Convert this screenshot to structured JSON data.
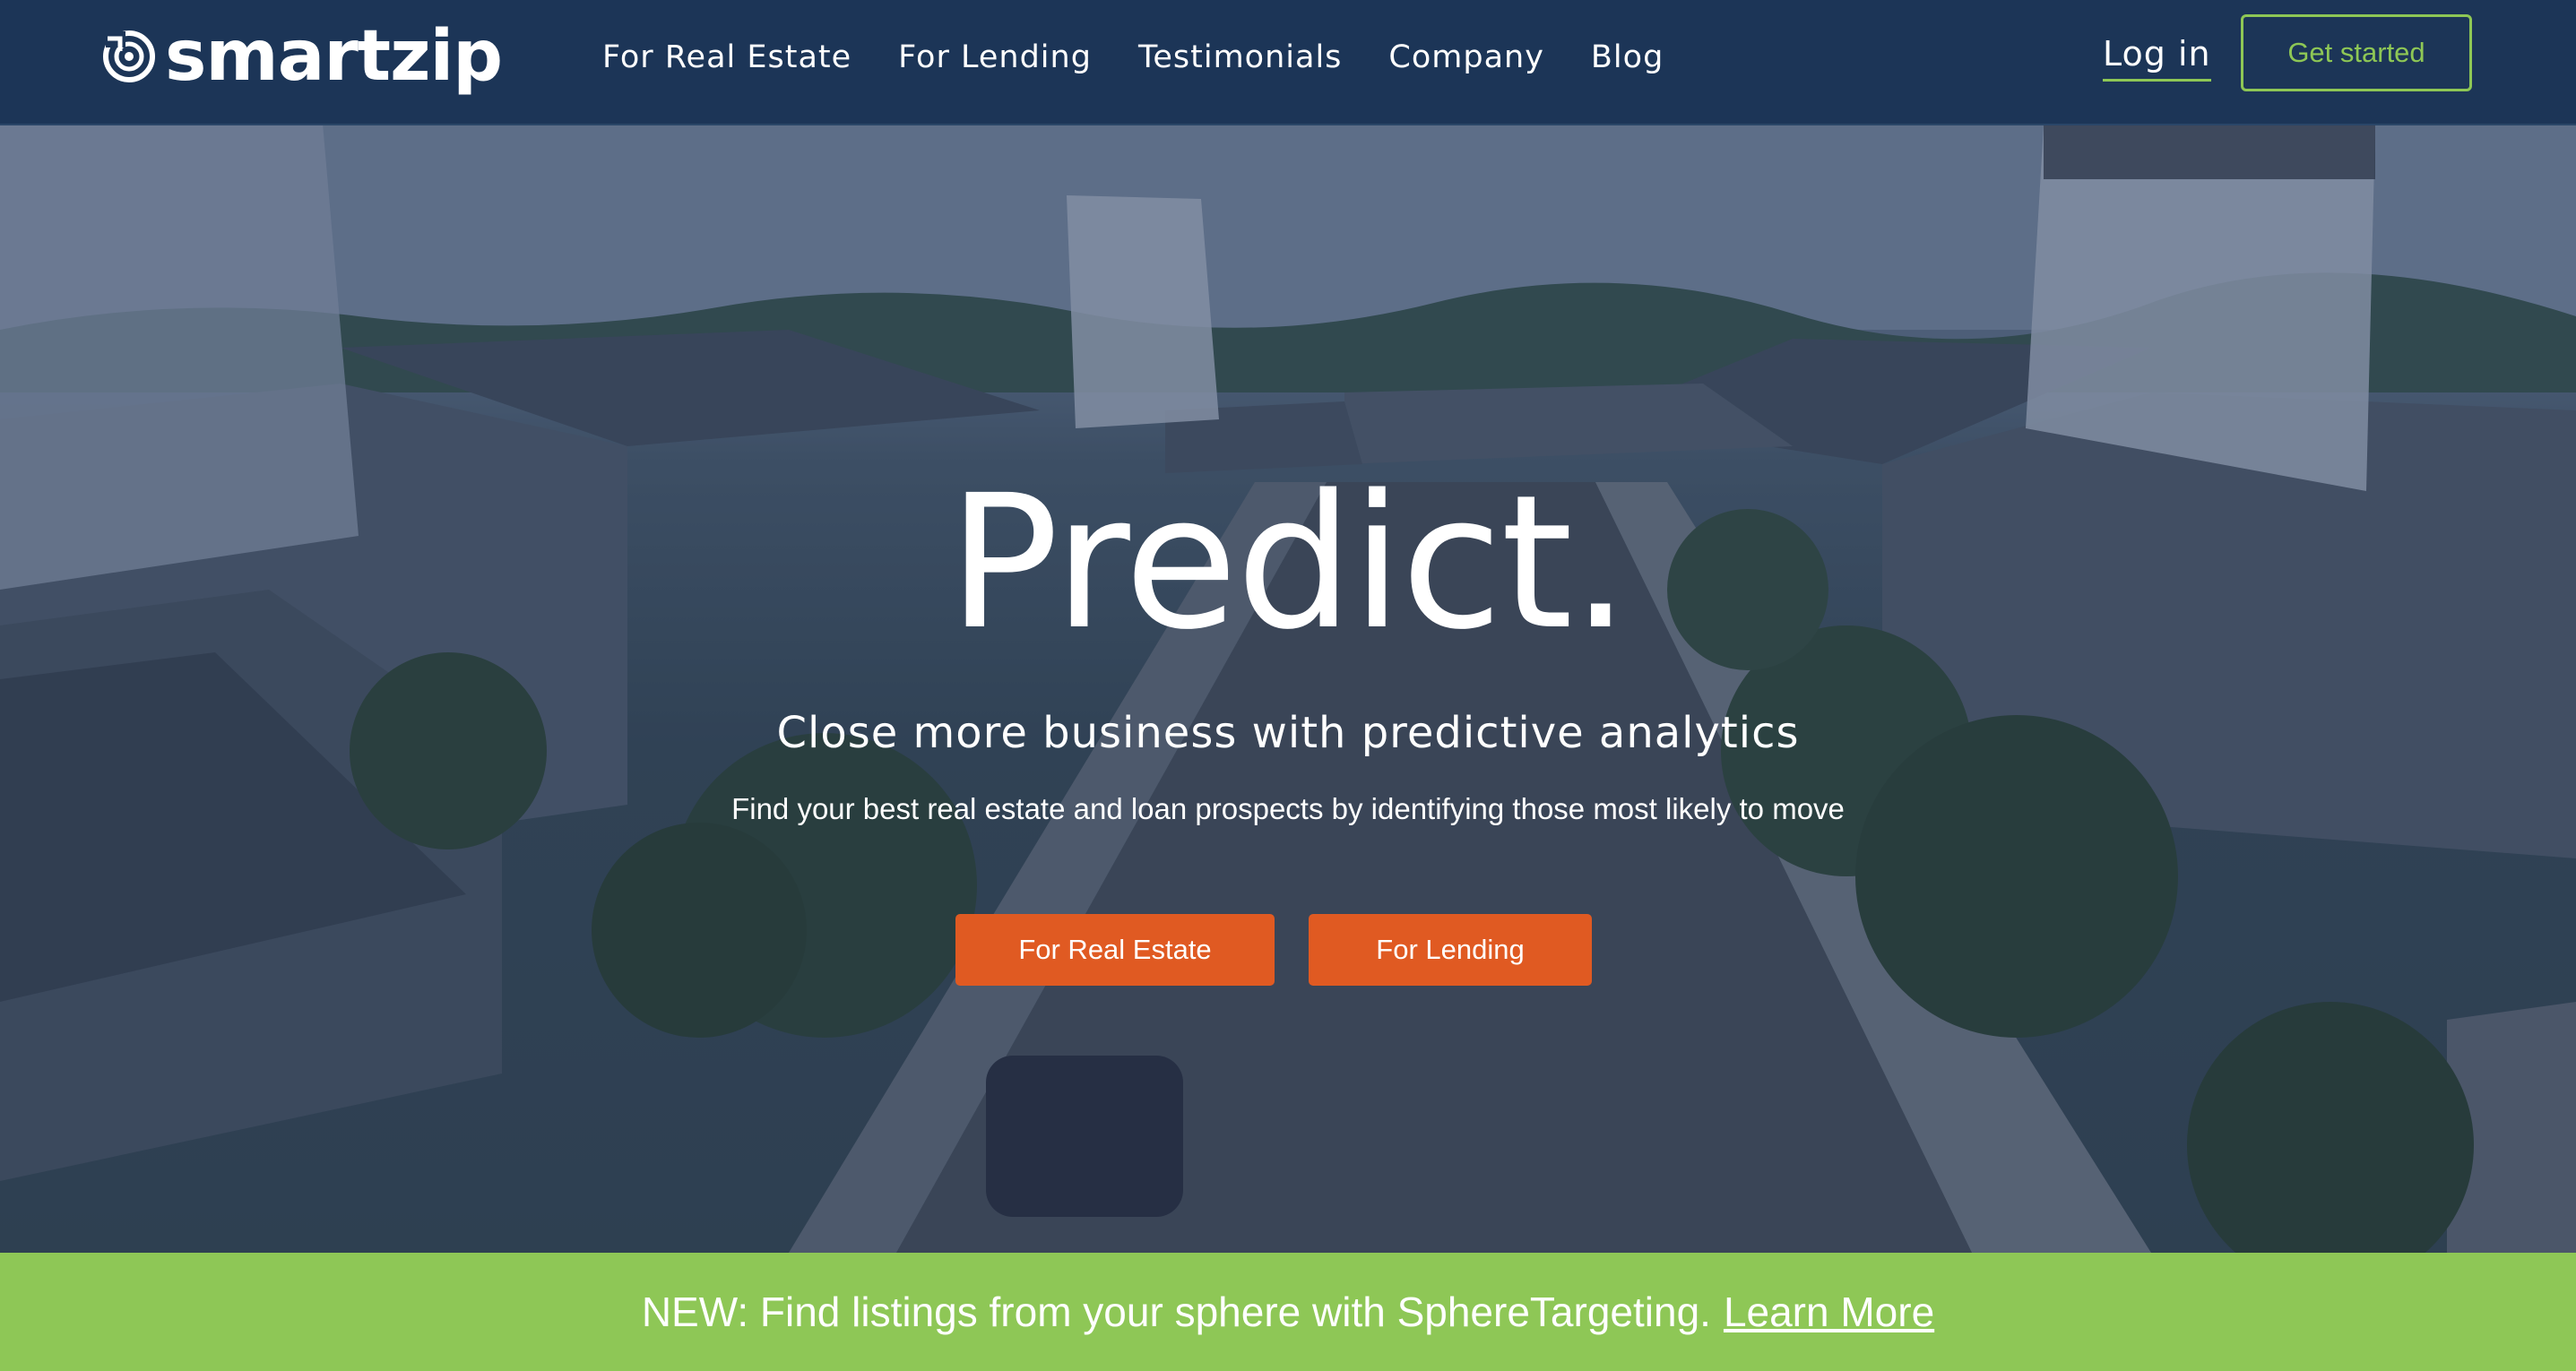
{
  "brand": {
    "name": "smartzip"
  },
  "nav": {
    "links": [
      "For Real Estate",
      "For Lending",
      "Testimonials",
      "Company",
      "Blog"
    ],
    "login": "Log in",
    "get_started": "Get started"
  },
  "hero": {
    "headline": "Predict.",
    "subhead": "Close more business with predictive analytics",
    "description": "Find your best real estate and loan prospects by identifying those most likely to move",
    "cta_real_estate": "For Real Estate",
    "cta_lending": "For Lending"
  },
  "banner": {
    "text": "NEW: Find listings from your sphere with SphereTargeting.",
    "link": "Learn More"
  },
  "colors": {
    "nav_bg": "#1c3557",
    "accent_green": "#8ec756",
    "cta_orange": "#e05a22"
  }
}
